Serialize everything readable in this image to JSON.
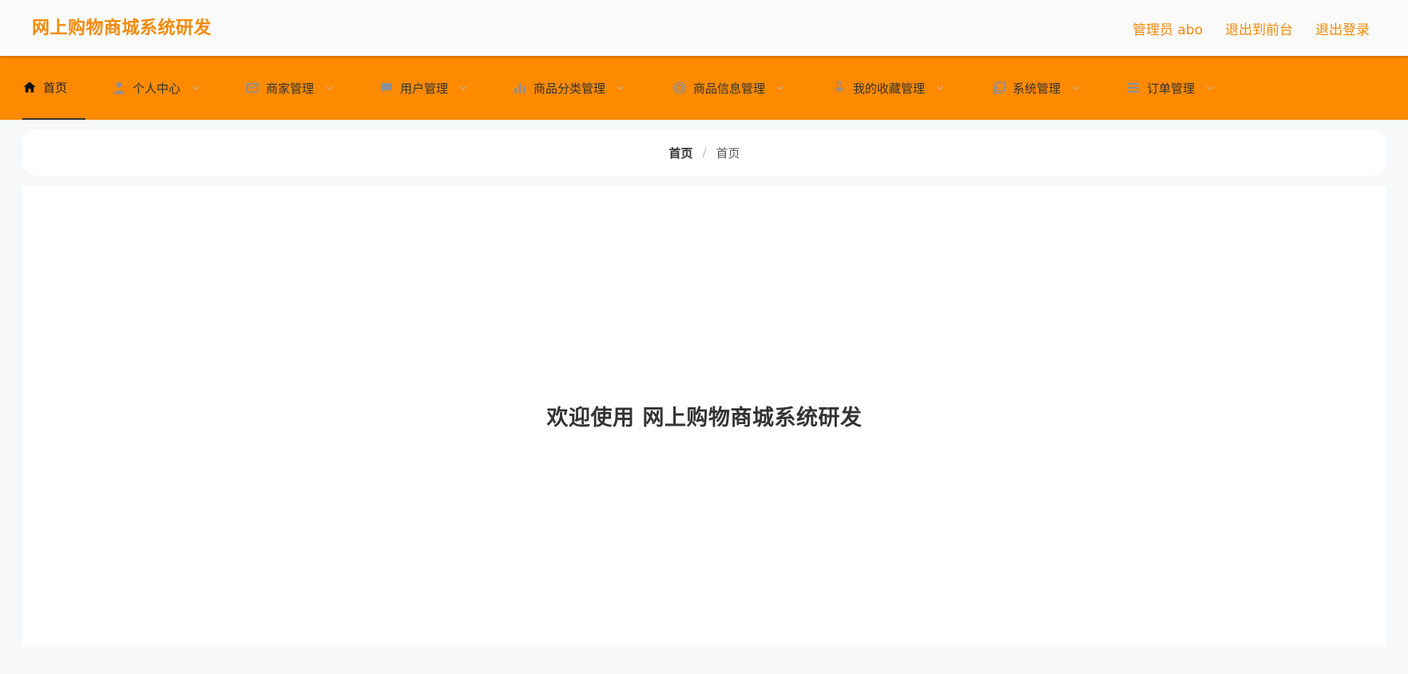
{
  "header": {
    "brand": "网上购物商城系统研发",
    "user_label": "管理员 abo",
    "exit_front_label": "退出到前台",
    "logout_label": "退出登录"
  },
  "nav": {
    "items": [
      {
        "label": "首页",
        "icon": "home-icon"
      },
      {
        "label": "个人中心",
        "icon": "user-icon"
      },
      {
        "label": "商家管理",
        "icon": "mail-icon"
      },
      {
        "label": "用户管理",
        "icon": "chat-icon"
      },
      {
        "label": "商品分类管理",
        "icon": "bar-chart-icon"
      },
      {
        "label": "商品信息管理",
        "icon": "target-icon"
      },
      {
        "label": "我的收藏管理",
        "icon": "microphone-icon"
      },
      {
        "label": "系统管理",
        "icon": "copy-icon"
      },
      {
        "label": "订单管理",
        "icon": "list-icon"
      }
    ]
  },
  "breadcrumb": {
    "root": "首页",
    "current": "首页"
  },
  "main": {
    "welcome": "欢迎使用 网上购物商城系统研发"
  },
  "colors": {
    "accent": "#fe8a00",
    "brand_text": "#f28a0c",
    "icon_gray": "#8a8f99"
  }
}
